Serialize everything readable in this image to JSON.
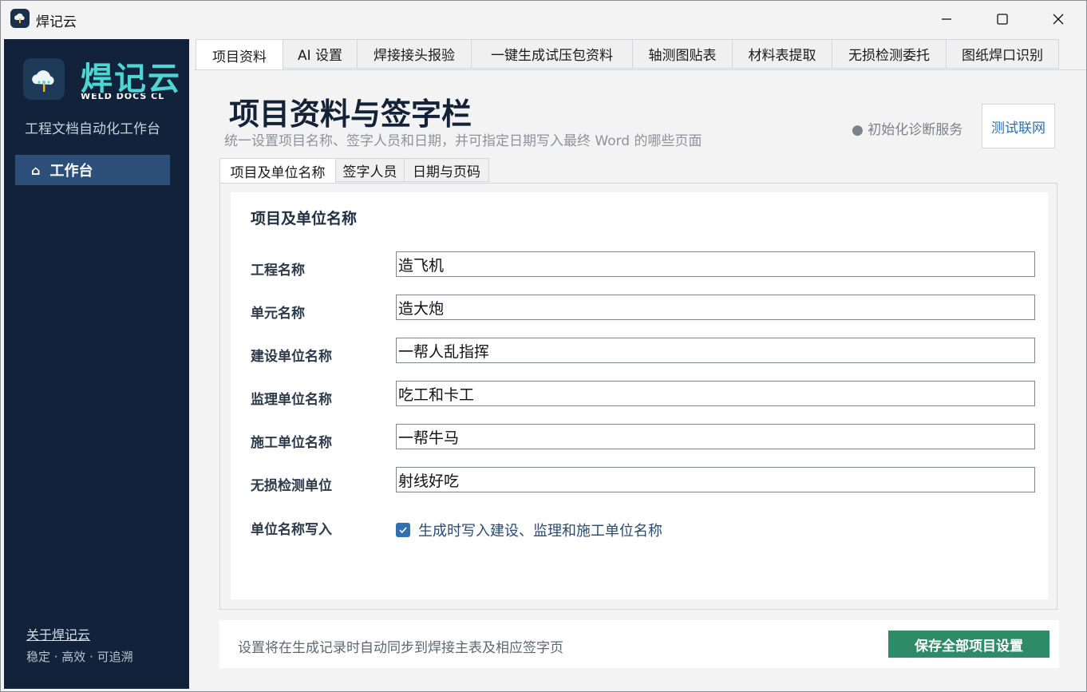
{
  "window": {
    "title": "焊记云"
  },
  "sidebar": {
    "logo_text": "焊记云",
    "logo_sub": "WELD DOCS CL",
    "tagline": "工程文档自动化工作台",
    "nav_active": "工作台",
    "about_link": "关于焊记云",
    "footer_text": "稳定 · 高效 · 可追溯"
  },
  "tabs": [
    "项目资料",
    "AI 设置",
    "焊接接头报验",
    "一键生成试压包资料",
    "轴测图贴表",
    "材料表提取",
    "无损检测委托",
    "图纸焊口识别"
  ],
  "header": {
    "title": "项目资料与签字栏",
    "subtitle": "统一设置项目名称、签字人员和日期，并可指定日期写入最终 Word 的哪些页面",
    "diag_status": "● 初始化诊断服务",
    "test_button": "测试联网"
  },
  "subtabs": [
    "项目及单位名称",
    "签字人员",
    "日期与页码"
  ],
  "section": {
    "title": "项目及单位名称",
    "fields": [
      {
        "label": "工程名称",
        "value": "造飞机"
      },
      {
        "label": "单元名称",
        "value": "造大炮"
      },
      {
        "label": "建设单位名称",
        "value": "一帮人乱指挥"
      },
      {
        "label": "监理单位名称",
        "value": "吃工和卡工"
      },
      {
        "label": "施工单位名称",
        "value": "一帮牛马"
      },
      {
        "label": "无损检测单位",
        "value": "射线好吃"
      }
    ],
    "checkbox_row_label": "单位名称写入",
    "checkbox_label": "生成时写入建设、监理和施工单位名称",
    "checkbox_checked": true
  },
  "footer": {
    "text": "设置将在生成记录时自动同步到焊接主表及相应签字页",
    "save_button": "保存全部项目设置"
  },
  "colors": {
    "sidebar_bg": "#11223a",
    "accent_teal": "#4dd6d2",
    "save_green": "#2e8a67",
    "link_blue": "#2f6fb2"
  }
}
